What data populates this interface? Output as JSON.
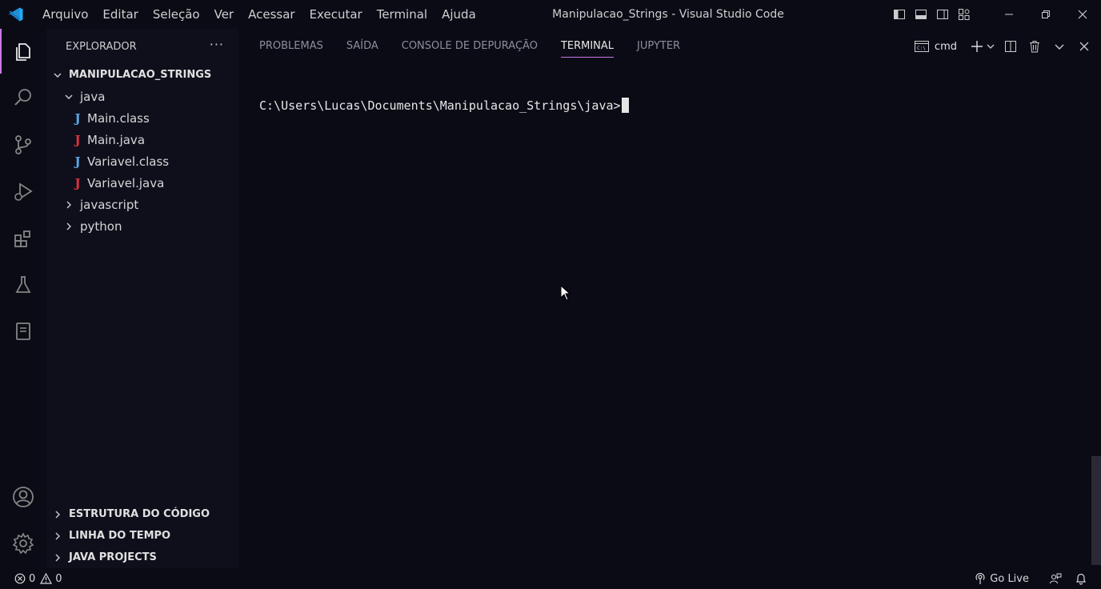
{
  "titlebar": {
    "menu": [
      "Arquivo",
      "Editar",
      "Seleção",
      "Ver",
      "Acessar",
      "Executar",
      "Terminal",
      "Ajuda"
    ],
    "window_title": "Manipulacao_Strings - Visual Studio Code",
    "logo_color": "#23a9f2"
  },
  "activitybar": {
    "items": [
      "explorer-icon",
      "search-icon",
      "source-control-icon",
      "run-debug-icon",
      "extensions-icon",
      "testing-icon",
      "notebook-icon"
    ],
    "bottom": [
      "accounts-icon",
      "settings-gear-icon"
    ],
    "accent": "#c87ae6"
  },
  "sidebar": {
    "title": "EXPLORADOR",
    "more": "···",
    "root": "MANIPULACAO_STRINGS",
    "folders": {
      "java": "java",
      "javascript": "javascript",
      "python": "python"
    },
    "files": [
      {
        "name": "Main.class",
        "icon": "J",
        "kind": "class"
      },
      {
        "name": "Main.java",
        "icon": "J",
        "kind": "java"
      },
      {
        "name": "Variavel.class",
        "icon": "J",
        "kind": "class"
      },
      {
        "name": "Variavel.java",
        "icon": "J",
        "kind": "java"
      }
    ],
    "sections": [
      "ESTRUTURA DO CÓDIGO",
      "LINHA DO TEMPO",
      "JAVA PROJECTS"
    ]
  },
  "panel": {
    "tabs": [
      "PROBLEMAS",
      "SAÍDA",
      "CONSOLE DE DEPURAÇÃO",
      "TERMINAL",
      "JUPYTER"
    ],
    "active_tab": "TERMINAL",
    "terminal_name": "cmd",
    "prompt": "C:\\Users\\Lucas\\Documents\\Manipulacao_Strings\\java>"
  },
  "statusbar": {
    "errors": "0",
    "warnings": "0",
    "go_live": "Go Live"
  }
}
